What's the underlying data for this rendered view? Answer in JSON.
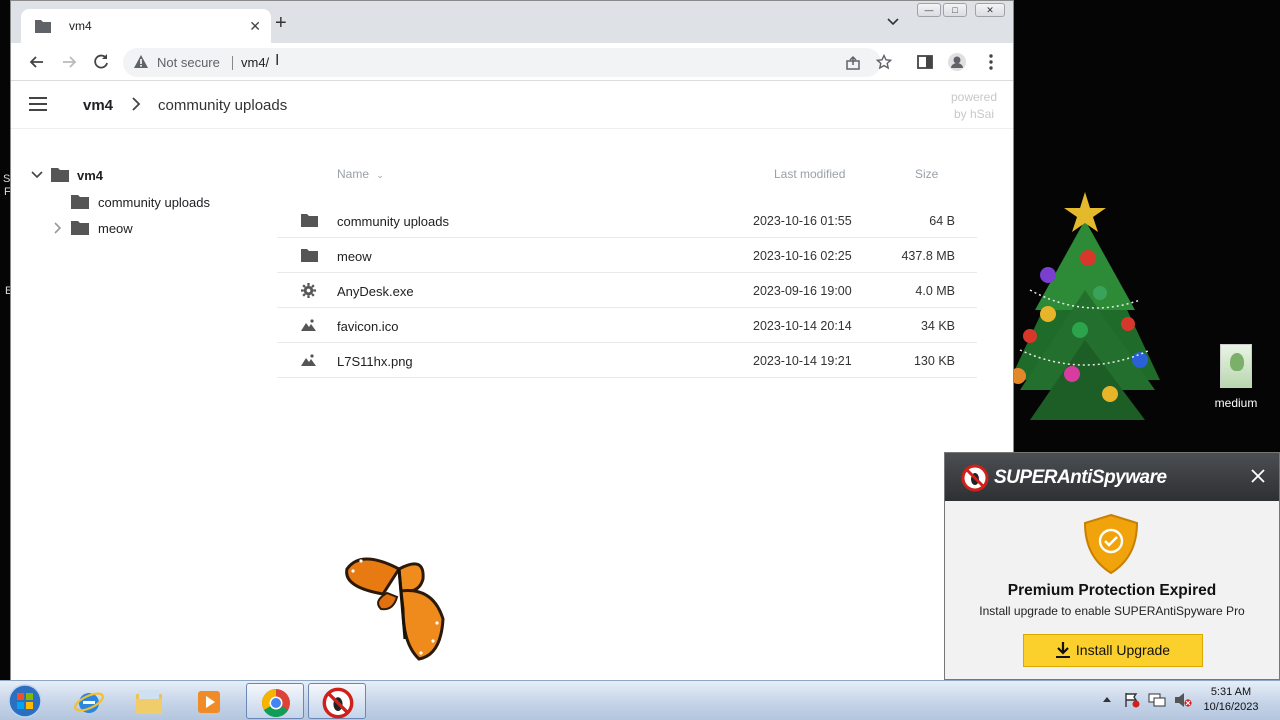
{
  "desktop": {
    "fragments": [
      "S",
      "F",
      "E"
    ],
    "icon_label": "medium"
  },
  "browser": {
    "tab_title": "vm4",
    "security_label": "Not secure",
    "url": "vm4/"
  },
  "page": {
    "breadcrumb_root": "vm4",
    "breadcrumb_current": "community uploads",
    "powered_line1": "powered",
    "powered_line2": "by hSai",
    "tree": [
      {
        "label": "vm4"
      },
      {
        "label": "community uploads"
      },
      {
        "label": "meow"
      }
    ],
    "columns": {
      "name": "Name",
      "modified": "Last modified",
      "size": "Size"
    },
    "files": [
      {
        "icon": "folder-icon",
        "name": "community uploads",
        "modified": "2023-10-16 01:55",
        "size": "64 B"
      },
      {
        "icon": "folder-icon",
        "name": "meow",
        "modified": "2023-10-16 02:25",
        "size": "437.8 MB"
      },
      {
        "icon": "gear-icon",
        "name": "AnyDesk.exe",
        "modified": "2023-09-16 19:00",
        "size": "4.0 MB"
      },
      {
        "icon": "image-icon",
        "name": "favicon.ico",
        "modified": "2023-10-14 20:14",
        "size": "34 KB"
      },
      {
        "icon": "image-icon",
        "name": "L7S11hx.png",
        "modified": "2023-10-14 19:21",
        "size": "130 KB"
      }
    ]
  },
  "popup": {
    "brand": "SUPERAntiSpyware",
    "title": "Premium Protection Expired",
    "subtitle": "Install upgrade to enable SUPERAntiSpyware Pro",
    "button": "Install Upgrade"
  },
  "taskbar": {
    "time": "5:31 AM",
    "date": "10/16/2023"
  },
  "colors": {
    "popup_button": "#fbcf2c",
    "popup_header": "#3a3c40",
    "shield": "#f0a30a"
  }
}
